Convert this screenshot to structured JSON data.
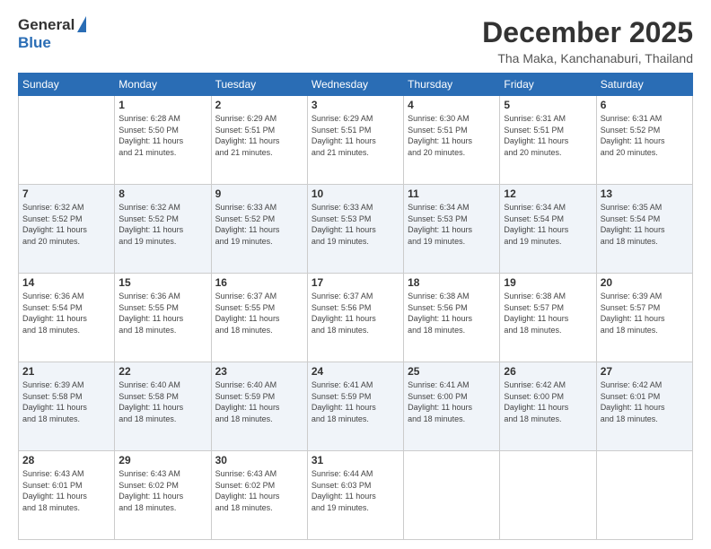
{
  "header": {
    "logo_general": "General",
    "logo_blue": "Blue",
    "title": "December 2025",
    "location": "Tha Maka, Kanchanaburi, Thailand"
  },
  "weekdays": [
    "Sunday",
    "Monday",
    "Tuesday",
    "Wednesday",
    "Thursday",
    "Friday",
    "Saturday"
  ],
  "weeks": [
    [
      {
        "day": "",
        "info": ""
      },
      {
        "day": "1",
        "info": "Sunrise: 6:28 AM\nSunset: 5:50 PM\nDaylight: 11 hours\nand 21 minutes."
      },
      {
        "day": "2",
        "info": "Sunrise: 6:29 AM\nSunset: 5:51 PM\nDaylight: 11 hours\nand 21 minutes."
      },
      {
        "day": "3",
        "info": "Sunrise: 6:29 AM\nSunset: 5:51 PM\nDaylight: 11 hours\nand 21 minutes."
      },
      {
        "day": "4",
        "info": "Sunrise: 6:30 AM\nSunset: 5:51 PM\nDaylight: 11 hours\nand 20 minutes."
      },
      {
        "day": "5",
        "info": "Sunrise: 6:31 AM\nSunset: 5:51 PM\nDaylight: 11 hours\nand 20 minutes."
      },
      {
        "day": "6",
        "info": "Sunrise: 6:31 AM\nSunset: 5:52 PM\nDaylight: 11 hours\nand 20 minutes."
      }
    ],
    [
      {
        "day": "7",
        "info": "Sunrise: 6:32 AM\nSunset: 5:52 PM\nDaylight: 11 hours\nand 20 minutes."
      },
      {
        "day": "8",
        "info": "Sunrise: 6:32 AM\nSunset: 5:52 PM\nDaylight: 11 hours\nand 19 minutes."
      },
      {
        "day": "9",
        "info": "Sunrise: 6:33 AM\nSunset: 5:52 PM\nDaylight: 11 hours\nand 19 minutes."
      },
      {
        "day": "10",
        "info": "Sunrise: 6:33 AM\nSunset: 5:53 PM\nDaylight: 11 hours\nand 19 minutes."
      },
      {
        "day": "11",
        "info": "Sunrise: 6:34 AM\nSunset: 5:53 PM\nDaylight: 11 hours\nand 19 minutes."
      },
      {
        "day": "12",
        "info": "Sunrise: 6:34 AM\nSunset: 5:54 PM\nDaylight: 11 hours\nand 19 minutes."
      },
      {
        "day": "13",
        "info": "Sunrise: 6:35 AM\nSunset: 5:54 PM\nDaylight: 11 hours\nand 18 minutes."
      }
    ],
    [
      {
        "day": "14",
        "info": "Sunrise: 6:36 AM\nSunset: 5:54 PM\nDaylight: 11 hours\nand 18 minutes."
      },
      {
        "day": "15",
        "info": "Sunrise: 6:36 AM\nSunset: 5:55 PM\nDaylight: 11 hours\nand 18 minutes."
      },
      {
        "day": "16",
        "info": "Sunrise: 6:37 AM\nSunset: 5:55 PM\nDaylight: 11 hours\nand 18 minutes."
      },
      {
        "day": "17",
        "info": "Sunrise: 6:37 AM\nSunset: 5:56 PM\nDaylight: 11 hours\nand 18 minutes."
      },
      {
        "day": "18",
        "info": "Sunrise: 6:38 AM\nSunset: 5:56 PM\nDaylight: 11 hours\nand 18 minutes."
      },
      {
        "day": "19",
        "info": "Sunrise: 6:38 AM\nSunset: 5:57 PM\nDaylight: 11 hours\nand 18 minutes."
      },
      {
        "day": "20",
        "info": "Sunrise: 6:39 AM\nSunset: 5:57 PM\nDaylight: 11 hours\nand 18 minutes."
      }
    ],
    [
      {
        "day": "21",
        "info": "Sunrise: 6:39 AM\nSunset: 5:58 PM\nDaylight: 11 hours\nand 18 minutes."
      },
      {
        "day": "22",
        "info": "Sunrise: 6:40 AM\nSunset: 5:58 PM\nDaylight: 11 hours\nand 18 minutes."
      },
      {
        "day": "23",
        "info": "Sunrise: 6:40 AM\nSunset: 5:59 PM\nDaylight: 11 hours\nand 18 minutes."
      },
      {
        "day": "24",
        "info": "Sunrise: 6:41 AM\nSunset: 5:59 PM\nDaylight: 11 hours\nand 18 minutes."
      },
      {
        "day": "25",
        "info": "Sunrise: 6:41 AM\nSunset: 6:00 PM\nDaylight: 11 hours\nand 18 minutes."
      },
      {
        "day": "26",
        "info": "Sunrise: 6:42 AM\nSunset: 6:00 PM\nDaylight: 11 hours\nand 18 minutes."
      },
      {
        "day": "27",
        "info": "Sunrise: 6:42 AM\nSunset: 6:01 PM\nDaylight: 11 hours\nand 18 minutes."
      }
    ],
    [
      {
        "day": "28",
        "info": "Sunrise: 6:43 AM\nSunset: 6:01 PM\nDaylight: 11 hours\nand 18 minutes."
      },
      {
        "day": "29",
        "info": "Sunrise: 6:43 AM\nSunset: 6:02 PM\nDaylight: 11 hours\nand 18 minutes."
      },
      {
        "day": "30",
        "info": "Sunrise: 6:43 AM\nSunset: 6:02 PM\nDaylight: 11 hours\nand 18 minutes."
      },
      {
        "day": "31",
        "info": "Sunrise: 6:44 AM\nSunset: 6:03 PM\nDaylight: 11 hours\nand 19 minutes."
      },
      {
        "day": "",
        "info": ""
      },
      {
        "day": "",
        "info": ""
      },
      {
        "day": "",
        "info": ""
      }
    ]
  ]
}
